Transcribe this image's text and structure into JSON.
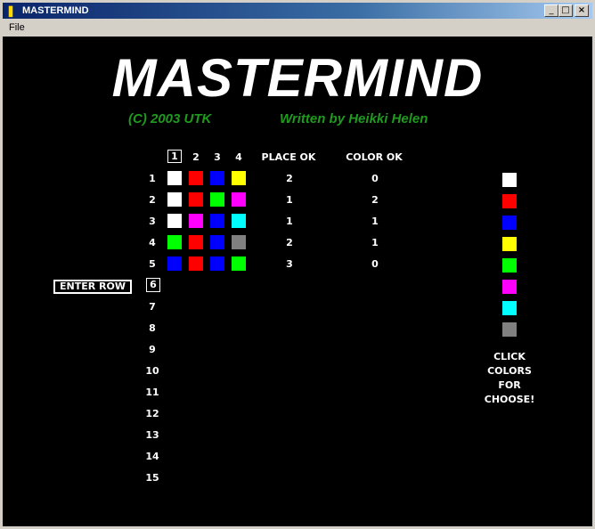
{
  "window": {
    "title": "MASTERMIND"
  },
  "menu": {
    "file": "File"
  },
  "game": {
    "title": "MASTERMIND",
    "copyright": "(C) 2003 UTK",
    "author": "Written by Heikki Helen",
    "columns": [
      "1",
      "2",
      "3",
      "4"
    ],
    "place_ok_label": "PLACE OK",
    "color_ok_label": "COLOR OK",
    "enter_row_label": "ENTER ROW",
    "current_row": 6,
    "selected_column": 1,
    "rows": [
      {
        "num": "1",
        "pegs": [
          "#ffffff",
          "#ff0000",
          "#0000ff",
          "#ffff00"
        ],
        "place_ok": "2",
        "color_ok": "0"
      },
      {
        "num": "2",
        "pegs": [
          "#ffffff",
          "#ff0000",
          "#00ff00",
          "#ff00ff"
        ],
        "place_ok": "1",
        "color_ok": "2"
      },
      {
        "num": "3",
        "pegs": [
          "#ffffff",
          "#ff00ff",
          "#0000ff",
          "#00ffff"
        ],
        "place_ok": "1",
        "color_ok": "1"
      },
      {
        "num": "4",
        "pegs": [
          "#00ff00",
          "#ff0000",
          "#0000ff",
          "#808080"
        ],
        "place_ok": "2",
        "color_ok": "1"
      },
      {
        "num": "5",
        "pegs": [
          "#0000ff",
          "#ff0000",
          "#0000ff",
          "#00ff00"
        ],
        "place_ok": "3",
        "color_ok": "0"
      },
      {
        "num": "6",
        "pegs": [],
        "place_ok": "",
        "color_ok": ""
      },
      {
        "num": "7",
        "pegs": [],
        "place_ok": "",
        "color_ok": ""
      },
      {
        "num": "8",
        "pegs": [],
        "place_ok": "",
        "color_ok": ""
      },
      {
        "num": "9",
        "pegs": [],
        "place_ok": "",
        "color_ok": ""
      },
      {
        "num": "10",
        "pegs": [],
        "place_ok": "",
        "color_ok": ""
      },
      {
        "num": "11",
        "pegs": [],
        "place_ok": "",
        "color_ok": ""
      },
      {
        "num": "12",
        "pegs": [],
        "place_ok": "",
        "color_ok": ""
      },
      {
        "num": "13",
        "pegs": [],
        "place_ok": "",
        "color_ok": ""
      },
      {
        "num": "14",
        "pegs": [],
        "place_ok": "",
        "color_ok": ""
      },
      {
        "num": "15",
        "pegs": [],
        "place_ok": "",
        "color_ok": ""
      }
    ],
    "palette": [
      "#ffffff",
      "#ff0000",
      "#0000ff",
      "#ffff00",
      "#00ff00",
      "#ff00ff",
      "#00ffff",
      "#808080"
    ],
    "palette_color_names": [
      "white",
      "red",
      "blue",
      "yellow",
      "green",
      "magenta",
      "cyan",
      "gray"
    ],
    "hint_lines": [
      "CLICK",
      "COLORS",
      "FOR",
      "CHOOSE!"
    ]
  },
  "colors": {
    "background": "#000000",
    "subtitle": "#1f9a1f",
    "text": "#ffffff"
  }
}
